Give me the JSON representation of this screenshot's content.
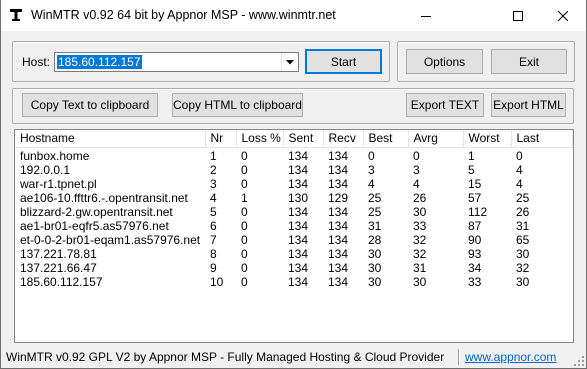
{
  "window": {
    "title": "WinMTR v0.92 64 bit by Appnor MSP - www.winmtr.net",
    "icon": "winmtr-app-icon",
    "controls": [
      "minimize-icon",
      "maximize-icon",
      "close-icon"
    ]
  },
  "host": {
    "label": "Host:",
    "value": "185.60.112.157"
  },
  "buttons": {
    "start": "Start",
    "options": "Options",
    "exit": "Exit",
    "copy_text": "Copy Text to clipboard",
    "copy_html": "Copy HTML to clipboard",
    "export_text": "Export TEXT",
    "export_html": "Export HTML"
  },
  "table": {
    "columns": [
      "Hostname",
      "Nr",
      "Loss %",
      "Sent",
      "Recv",
      "Best",
      "Avrg",
      "Worst",
      "Last"
    ],
    "rows": [
      [
        "funbox.home",
        "1",
        "0",
        "134",
        "134",
        "0",
        "0",
        "1",
        "0"
      ],
      [
        "192.0.0.1",
        "2",
        "0",
        "134",
        "134",
        "3",
        "3",
        "5",
        "4"
      ],
      [
        "war-r1.tpnet.pl",
        "3",
        "0",
        "134",
        "134",
        "4",
        "4",
        "15",
        "4"
      ],
      [
        "ae106-10.ffttr6.-.opentransit.net",
        "4",
        "1",
        "130",
        "129",
        "25",
        "26",
        "57",
        "25"
      ],
      [
        "blizzard-2.gw.opentransit.net",
        "5",
        "0",
        "134",
        "134",
        "25",
        "30",
        "112",
        "26"
      ],
      [
        "ae1-br01-eqfr5.as57976.net",
        "6",
        "0",
        "134",
        "134",
        "31",
        "33",
        "87",
        "31"
      ],
      [
        "et-0-0-2-br01-eqam1.as57976.net",
        "7",
        "0",
        "134",
        "134",
        "28",
        "32",
        "90",
        "65"
      ],
      [
        "137.221.78.81",
        "8",
        "0",
        "134",
        "134",
        "30",
        "32",
        "93",
        "30"
      ],
      [
        "137.221.66.47",
        "9",
        "0",
        "134",
        "134",
        "30",
        "31",
        "34",
        "32"
      ],
      [
        "185.60.112.157",
        "10",
        "0",
        "134",
        "134",
        "30",
        "30",
        "33",
        "30"
      ]
    ]
  },
  "status": {
    "text": "WinMTR v0.92 GPL V2 by Appnor MSP - Fully Managed Hosting & Cloud Provider",
    "link": "www.appnor.com"
  },
  "colors": {
    "selection": "#0078d7",
    "link": "#0066cc",
    "face": "#f0f0f0",
    "button": "#e1e1e1"
  }
}
